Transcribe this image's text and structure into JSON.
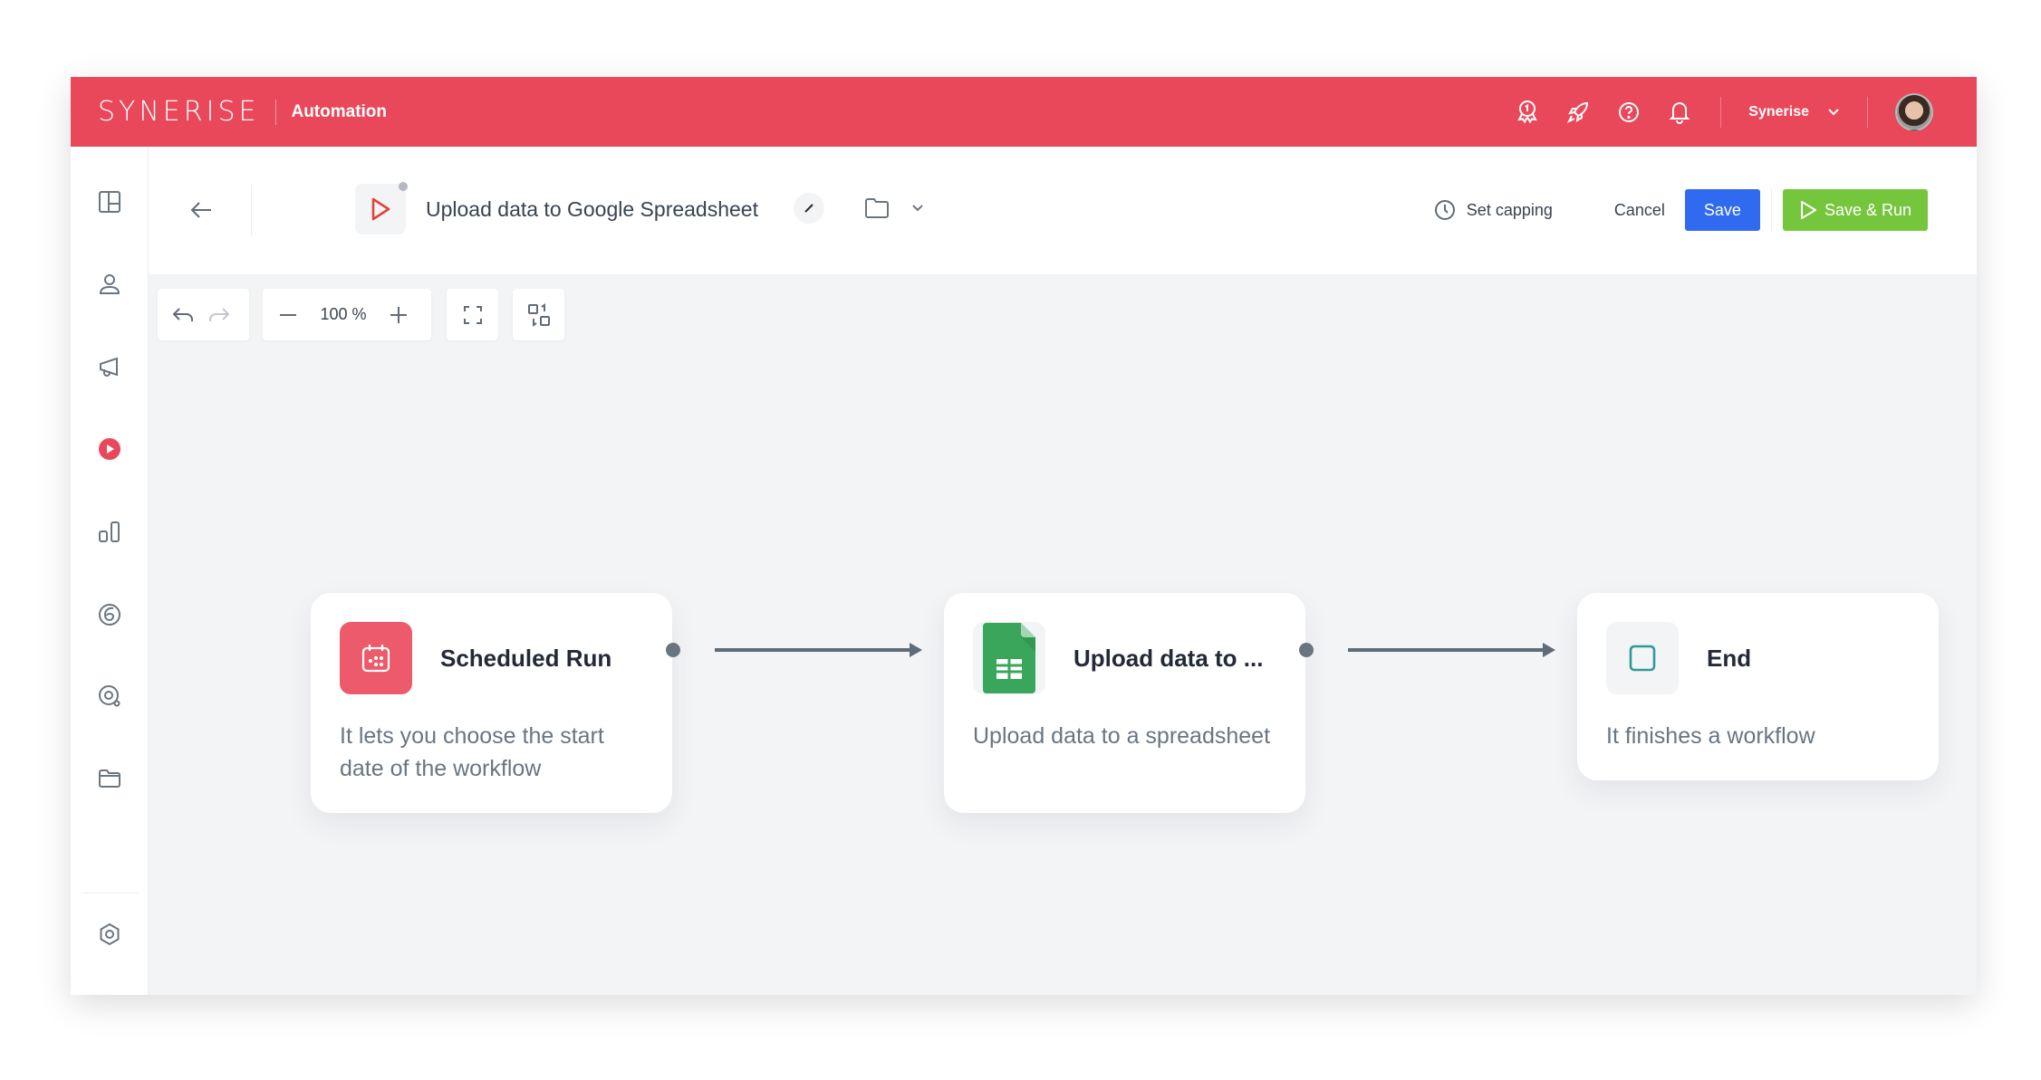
{
  "topbar": {
    "logo": "SYNERISE",
    "app_name": "Automation",
    "icons": [
      "award-icon",
      "rocket-icon",
      "help-icon",
      "bell-icon"
    ],
    "workspace": "Synerise",
    "brand_color": "#e9475a"
  },
  "sidebar": {
    "items": [
      {
        "name": "dashboard",
        "icon": "layout-icon",
        "active": false
      },
      {
        "name": "profiles",
        "icon": "user-icon",
        "active": false
      },
      {
        "name": "campaigns",
        "icon": "megaphone-icon",
        "active": false
      },
      {
        "name": "automation",
        "icon": "play-circle-icon",
        "active": true
      },
      {
        "name": "analytics",
        "icon": "bar-chart-icon",
        "active": false
      },
      {
        "name": "ai",
        "icon": "swirl-icon",
        "active": false
      },
      {
        "name": "search",
        "icon": "search-icon",
        "active": false
      },
      {
        "name": "assets",
        "icon": "folder-icon",
        "active": false
      }
    ],
    "settings_icon": "settings-icon"
  },
  "header": {
    "title": "Upload data to Google Spreadsheet",
    "set_capping_label": "Set capping",
    "cancel_label": "Cancel",
    "save_label": "Save",
    "save_run_label": "Save & Run",
    "save_color": "#2f6af0",
    "run_color": "#76c63d"
  },
  "canvas_controls": {
    "zoom": "100 %"
  },
  "nodes": [
    {
      "title": "Scheduled Run",
      "description": "It lets you choose the start date of the workflow",
      "icon": "calendar-icon",
      "icon_bg": "#ec5a6c"
    },
    {
      "title": "Upload data to ...",
      "description": "Upload data to a spreadsheet",
      "icon": "google-sheets-icon",
      "icon_bg": "#f3f4f6"
    },
    {
      "title": "End",
      "description": "It finishes a workflow",
      "icon": "stop-square-icon",
      "icon_bg": "#f3f4f6"
    }
  ]
}
